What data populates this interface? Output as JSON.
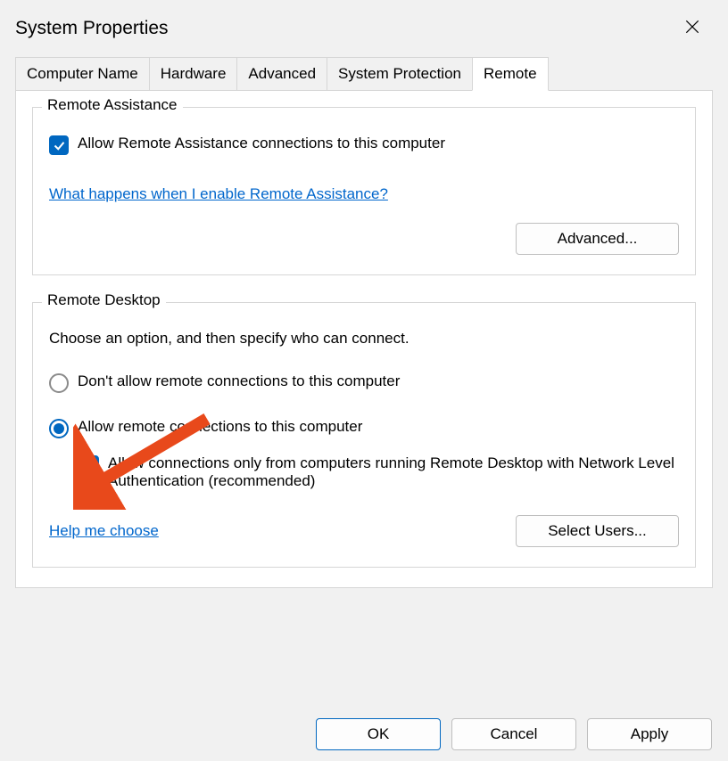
{
  "window": {
    "title": "System Properties"
  },
  "tabs": [
    {
      "label": "Computer Name"
    },
    {
      "label": "Hardware"
    },
    {
      "label": "Advanced"
    },
    {
      "label": "System Protection"
    },
    {
      "label": "Remote",
      "active": true
    }
  ],
  "remote_assistance": {
    "group_title": "Remote Assistance",
    "allow_checkbox_label": "Allow Remote Assistance connections to this computer",
    "help_link": "What happens when I enable Remote Assistance?",
    "advanced_button": "Advanced..."
  },
  "remote_desktop": {
    "group_title": "Remote Desktop",
    "description": "Choose an option, and then specify who can connect.",
    "radio_dont_allow": "Don't allow remote connections to this computer",
    "radio_allow": "Allow remote connections to this computer",
    "nla_checkbox_label": "Allow connections only from computers running Remote Desktop with Network Level Authentication (recommended)",
    "help_link": "Help me choose",
    "select_users_button": "Select Users..."
  },
  "footer": {
    "ok": "OK",
    "cancel": "Cancel",
    "apply": "Apply"
  }
}
